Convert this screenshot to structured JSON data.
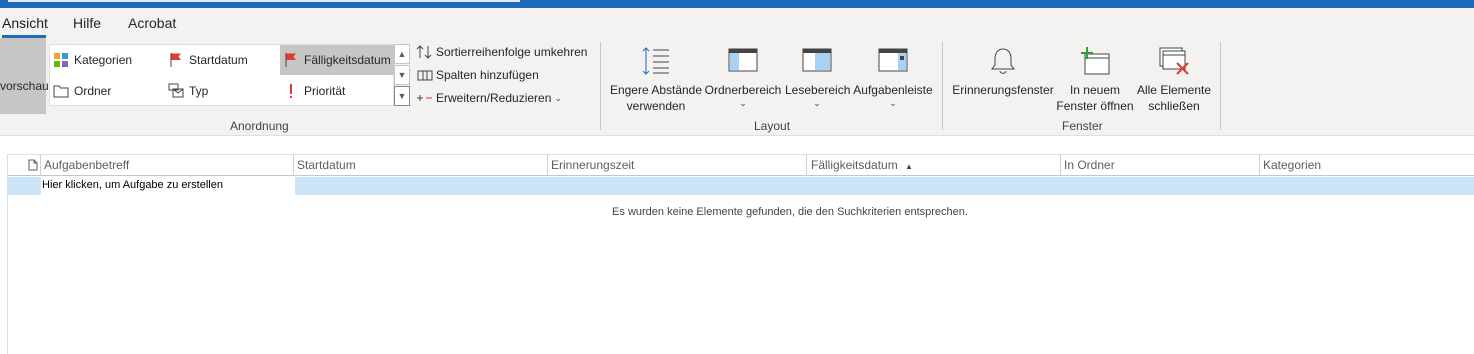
{
  "tabs": [
    {
      "label": "Ansicht",
      "active": true
    },
    {
      "label": "Hilfe"
    },
    {
      "label": "Acrobat"
    }
  ],
  "ribbon": {
    "preview_label": "vorschau",
    "arrangement": {
      "items": [
        {
          "label": "Kategorien",
          "icon": "categories-icon"
        },
        {
          "label": "Startdatum",
          "icon": "red-flag-icon"
        },
        {
          "label": "Fälligkeitsdatum",
          "icon": "red-flag-icon",
          "selected": true
        },
        {
          "label": "Ordner",
          "icon": "folder-icon"
        },
        {
          "label": "Typ",
          "icon": "type-icon"
        },
        {
          "label": "Priorität",
          "icon": "exclamation-icon"
        }
      ],
      "commands": {
        "reverse_sort": "Sortierreihenfolge umkehren",
        "add_columns": "Spalten hinzufügen",
        "expand_collapse": "Erweitern/Reduzieren"
      },
      "group_label": "Anordnung"
    },
    "layout": {
      "buttons": {
        "compact": {
          "line1": "Engere Abstände",
          "line2": "verwenden"
        },
        "folder_pane": "Ordnerbereich",
        "reading_pane": "Lesebereich",
        "todo_bar": "Aufgabenleiste"
      },
      "group_label": "Layout"
    },
    "window": {
      "buttons": {
        "reminders": "Erinnerungsfenster",
        "new_window": {
          "line1": "In neuem",
          "line2": "Fenster öffnen"
        },
        "close_all": {
          "line1": "Alle Elemente",
          "line2": "schließen"
        }
      },
      "group_label": "Fenster"
    }
  },
  "table": {
    "columns": {
      "subject": "Aufgabenbetreff",
      "start": "Startdatum",
      "reminder": "Erinnerungszeit",
      "due": "Fälligkeitsdatum",
      "folder": "In Ordner",
      "categories": "Kategorien"
    },
    "new_task_placeholder": "Hier klicken, um Aufgabe zu erstellen",
    "empty_message": "Es wurden keine Elemente gefunden, die den Suchkriterien entsprechen."
  },
  "colors": {
    "accent": "#1c6bbf",
    "ribbon_bg": "#f3f2f1",
    "selected_row": "#cce4f7",
    "flag_red": "#e03c31"
  }
}
